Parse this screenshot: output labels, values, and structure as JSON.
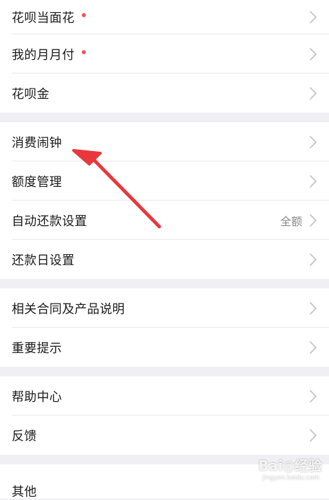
{
  "groups": [
    {
      "items": [
        {
          "label": "花呗当面花",
          "dot": true
        },
        {
          "label": "我的月月付",
          "dot": true
        },
        {
          "label": "花呗金"
        }
      ]
    },
    {
      "items": [
        {
          "label": "消费闹钟"
        },
        {
          "label": "额度管理"
        },
        {
          "label": "自动还款设置",
          "value": "全额"
        },
        {
          "label": "还款日设置"
        }
      ]
    },
    {
      "items": [
        {
          "label": "相关合同及产品说明"
        },
        {
          "label": "重要提示"
        }
      ]
    },
    {
      "items": [
        {
          "label": "帮助中心"
        },
        {
          "label": "反馈"
        }
      ]
    },
    {
      "items": [
        {
          "label": "其他"
        }
      ]
    }
  ],
  "colors": {
    "background": "#efeff4",
    "badge_dot": "#f0555e",
    "arrow": "#e8383d",
    "chevron": "#c4c4c8"
  },
  "icons": {
    "row_chevron": "chevron-right-icon",
    "annotation": "red-arrow-pointer"
  },
  "watermark": {
    "main": "Bai◎经验",
    "sub": "jingyan.baidu.com"
  }
}
